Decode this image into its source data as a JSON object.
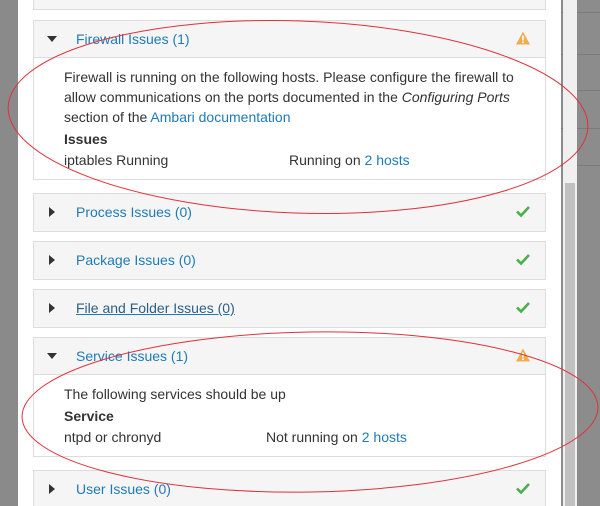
{
  "panels": {
    "firewall": {
      "title": "Firewall Issues (1)",
      "status": "warning",
      "message_part1": "Firewall is running on the following hosts. Please configure the firewall to allow communications on the ports documented in the ",
      "message_em": "Configuring Ports",
      "message_part2": " section of the ",
      "message_link": "Ambari documentation",
      "issues_header": "Issues",
      "row_name": "iptables Running",
      "row_prefix": "Running on ",
      "row_link": "2 hosts"
    },
    "process": {
      "title": "Process Issues (0)",
      "status": "ok"
    },
    "package": {
      "title": "Package Issues (0)",
      "status": "ok"
    },
    "file_folder": {
      "title": "File and Folder Issues (0)",
      "status": "ok"
    },
    "service": {
      "title": "Service Issues (1)",
      "status": "warning",
      "message": "The following services should be up",
      "header": "Service",
      "row_name": "ntpd or chronyd",
      "row_prefix": "Not running on ",
      "row_link": "2 hosts"
    },
    "user": {
      "title": "User Issues (0)",
      "status": "ok"
    }
  },
  "colors": {
    "link": "#1f7ab8",
    "ok": "#4cae4c",
    "warning": "#f0ad4e",
    "annotation": "#e0303a"
  },
  "icons": {
    "ok": "check-icon",
    "warning": "warning-triangle-icon"
  }
}
